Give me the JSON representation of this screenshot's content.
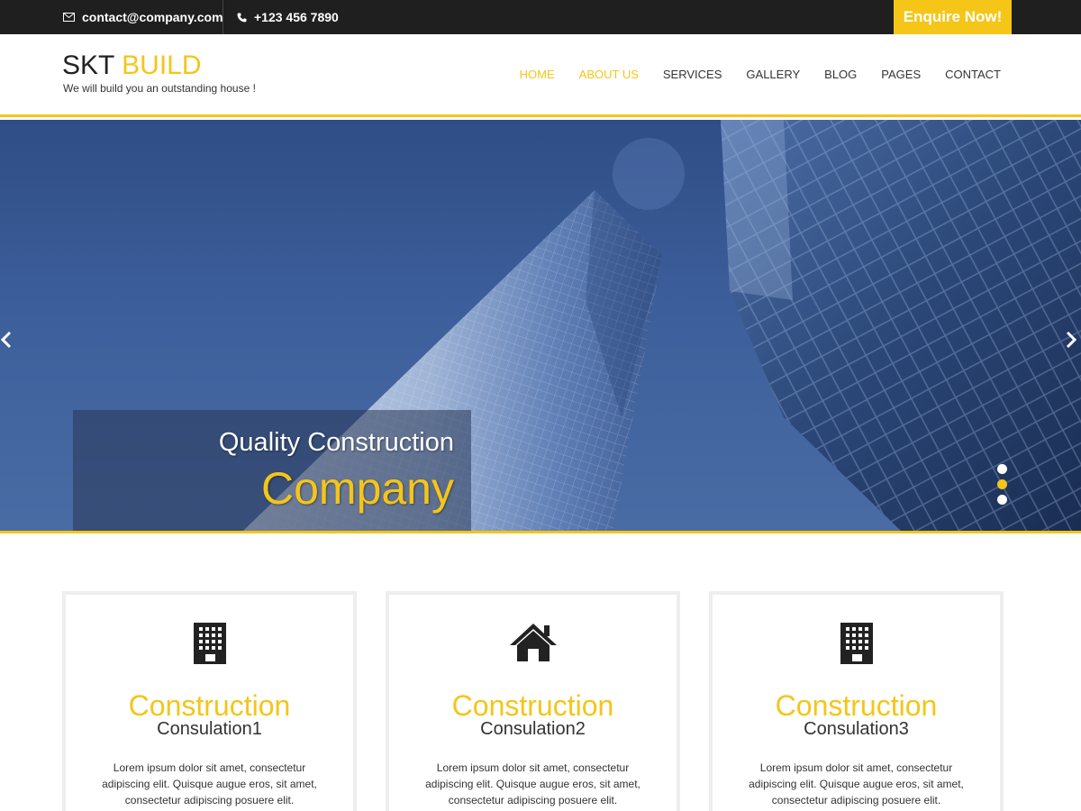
{
  "topbar": {
    "email": "contact@company.com",
    "phone": "+123 456 7890",
    "enquire_label": "Enquire Now!"
  },
  "header": {
    "logo_part1": "SKT",
    "logo_part2": "BUILD",
    "tagline": "We will build you an outstanding house !",
    "nav": [
      {
        "label": "HOME",
        "active": true
      },
      {
        "label": "ABOUT US",
        "active": true
      },
      {
        "label": "SERVICES",
        "active": false
      },
      {
        "label": "GALLERY",
        "active": false
      },
      {
        "label": "BLOG",
        "active": false
      },
      {
        "label": "PAGES",
        "active": false
      },
      {
        "label": "CONTACT",
        "active": false
      }
    ]
  },
  "hero": {
    "caption_line1": "Quality Construction",
    "caption_line2": "Company",
    "prev_icon": "chevron-left-icon",
    "next_icon": "chevron-right-icon",
    "slide_count": 3,
    "active_slide": 2
  },
  "cards": [
    {
      "icon": "building-icon",
      "title": "Construction",
      "subtitle": "Consulation1",
      "text": "Lorem ipsum dolor sit amet, consectetur adipiscing elit. Quisque augue eros, sit amet, consectetur adipiscing posuere elit."
    },
    {
      "icon": "home-icon",
      "title": "Construction",
      "subtitle": "Consulation2",
      "text": "Lorem ipsum dolor sit amet, consectetur adipiscing elit. Quisque augue eros, sit amet, consectetur adipiscing posuere elit."
    },
    {
      "icon": "building-icon",
      "title": "Construction",
      "subtitle": "Consulation3",
      "text": "Lorem ipsum dolor sit amet, consectetur adipiscing elit. Quisque augue eros, sit amet, consectetur adipiscing posuere elit."
    }
  ],
  "colors": {
    "accent": "#f5c518",
    "topbar_bg": "#1f1f1f",
    "text_dark": "#333333"
  }
}
